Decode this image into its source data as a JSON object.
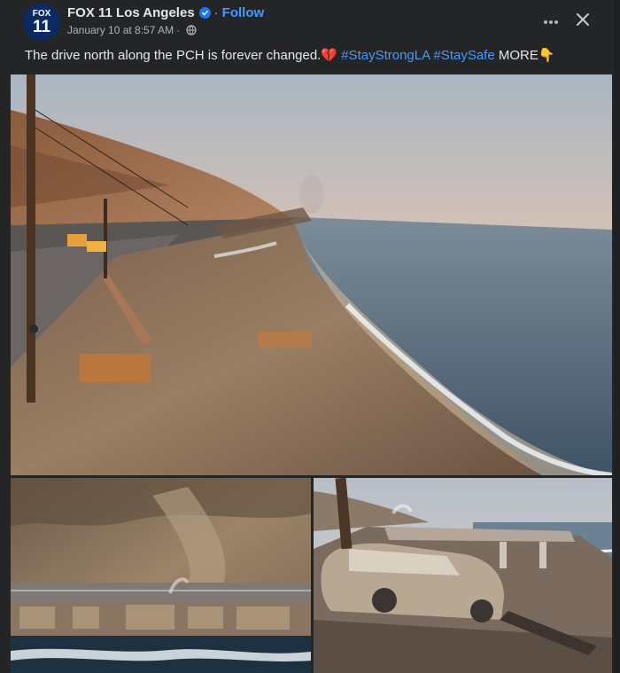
{
  "header": {
    "page_name": "FOX 11 Los Angeles",
    "avatar_top": "FOX",
    "avatar_bottom": "11",
    "separator": "·",
    "follow_label": "Follow",
    "timestamp": "January 10 at 8:57 AM",
    "timestamp_sep": "·"
  },
  "caption": {
    "text": "The drive north along the PCH is forever changed.",
    "emoji_heart": "💔",
    "hashtag_1": "#StayStrongLA",
    "hashtag_2": "#StaySafe",
    "more_label": "MORE",
    "emoji_point": "👇"
  },
  "colors": {
    "background": "#242526",
    "text": "#e4e6eb",
    "secondary_text": "#b0b3b8",
    "link": "#4599ff",
    "verified": "#1877f2"
  },
  "icons": [
    "verified-badge-icon",
    "globe-icon",
    "more-options-icon",
    "close-icon"
  ]
}
